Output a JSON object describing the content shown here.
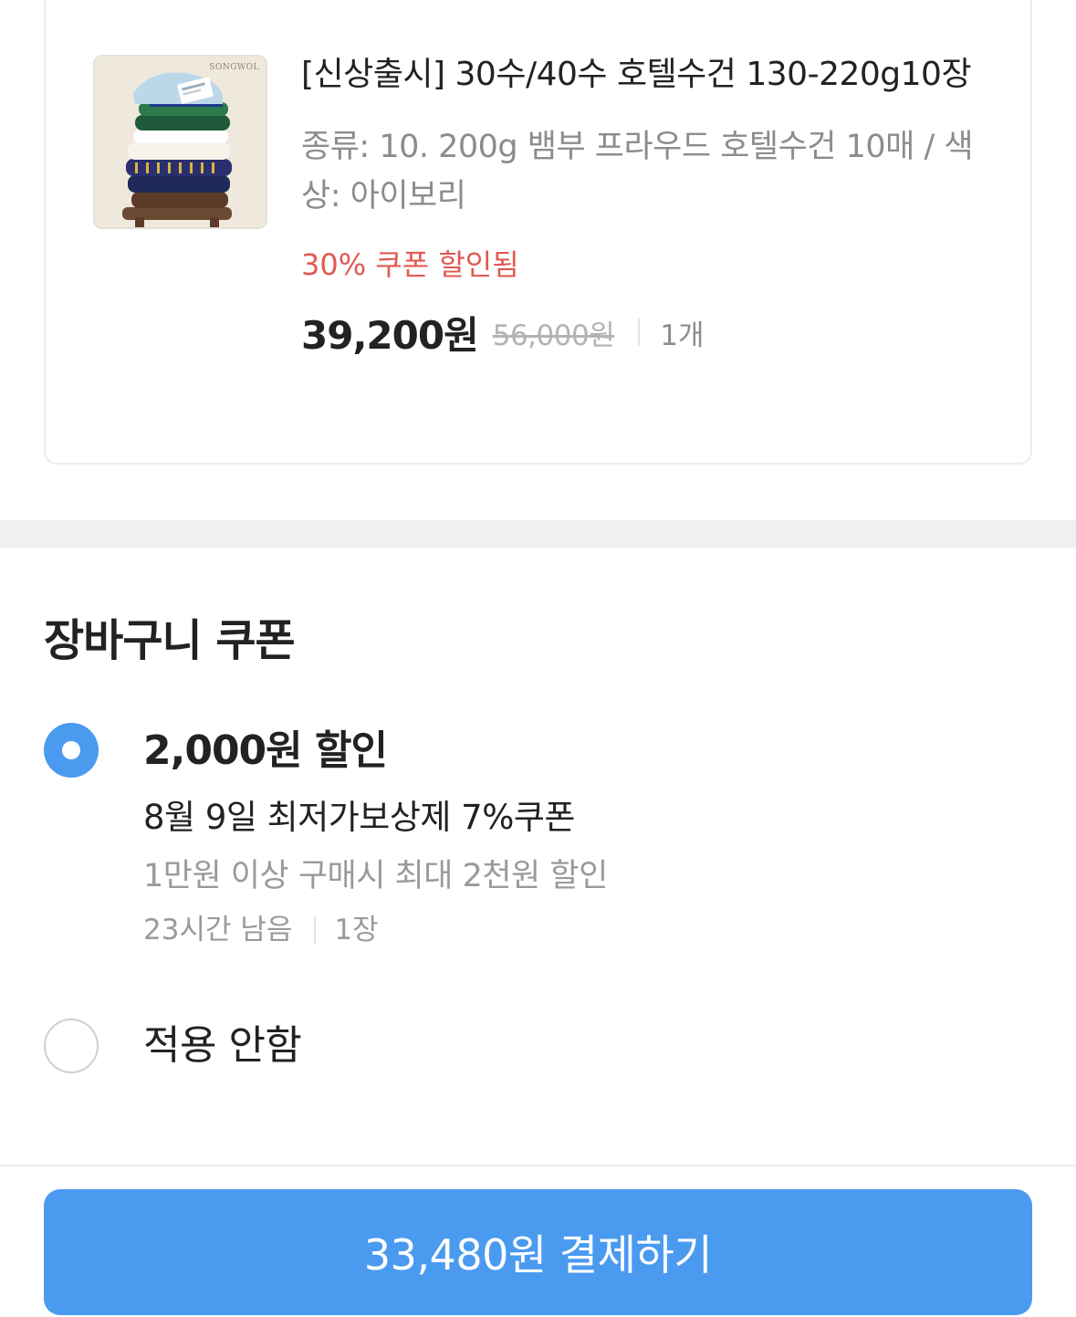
{
  "product": {
    "brand_label": "SONGWOL",
    "title": "[신상출시] 30수/40수 호텔수건 130-220g10장",
    "option": "종류: 10. 200g 뱀부 프라우드 호텔수건 10매 / 색상: 아이보리",
    "coupon_applied": "30% 쿠폰 할인됨",
    "price": "39,200원",
    "original_price": "56,000원",
    "quantity": "1개",
    "colors": {
      "discount_text": "#e05a52"
    }
  },
  "cart_coupon": {
    "section_title": "장바구니 쿠폰",
    "options": [
      {
        "amount": "2,000원 할인",
        "name": "8월 9일 최저가보상제 7%쿠폰",
        "condition": "1만원 이상 구매시 최대 2천원 할인",
        "time_left": "23시간 남음",
        "count": "1장",
        "selected": true
      },
      {
        "label": "적용 안함",
        "selected": false
      }
    ]
  },
  "checkout": {
    "button_label": "33,480원 결제하기",
    "colors": {
      "accent": "#4a9af0"
    }
  }
}
